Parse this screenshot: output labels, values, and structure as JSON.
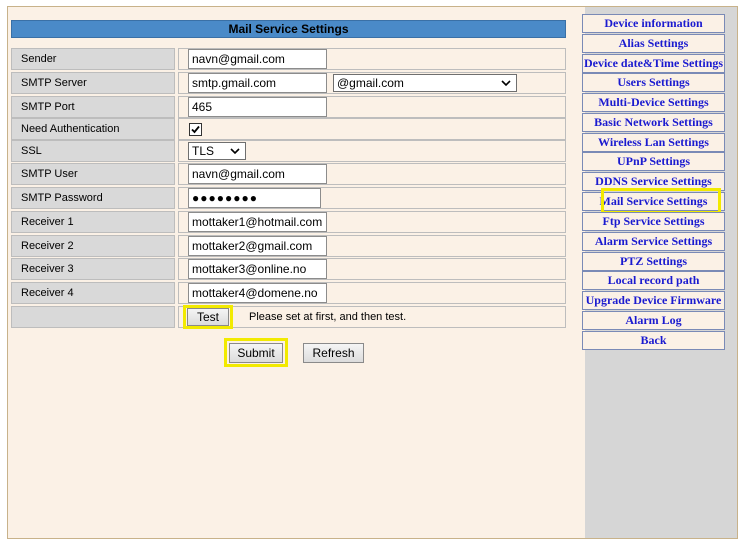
{
  "page": {
    "title": "Mail Service Settings"
  },
  "form": {
    "rows": [
      {
        "label": "Sender",
        "value": "navn@gmail.com"
      },
      {
        "label": "SMTP Server",
        "value": "smtp.gmail.com",
        "select": "@gmail.com"
      },
      {
        "label": "SMTP Port",
        "value": "465"
      },
      {
        "label": "Need Authentication",
        "checked": true
      },
      {
        "label": "SSL",
        "select": "TLS"
      },
      {
        "label": "SMTP User",
        "value": "navn@gmail.com"
      },
      {
        "label": "SMTP Password",
        "value": "●●●●●●●●"
      },
      {
        "label": "Receiver 1",
        "value": "mottaker1@hotmail.com"
      },
      {
        "label": "Receiver 2",
        "value": "mottaker2@gmail.com"
      },
      {
        "label": "Receiver 3",
        "value": "mottaker3@online.no"
      },
      {
        "label": "Receiver 4",
        "value": "mottaker4@domene.no"
      }
    ],
    "test_label": "Test",
    "test_hint": "Please set at first, and then test.",
    "submit_label": "Submit",
    "refresh_label": "Refresh"
  },
  "sidebar": {
    "items": [
      "Device information",
      "Alias Settings",
      "Device date&Time Settings",
      "Users Settings",
      "Multi-Device Settings",
      "Basic Network Settings",
      "Wireless Lan Settings",
      "UPnP Settings",
      "DDNS Service Settings",
      "Mail Service Settings",
      "Ftp Service Settings",
      "Alarm Service Settings",
      "PTZ Settings",
      "Local record path",
      "Upgrade Device Firmware",
      "Alarm Log",
      "Back"
    ],
    "active": "Mail Service Settings"
  },
  "colors": {
    "title_bar": "#4a8ac8",
    "highlight": "#f2ea00",
    "link": "#1a1ad0"
  }
}
